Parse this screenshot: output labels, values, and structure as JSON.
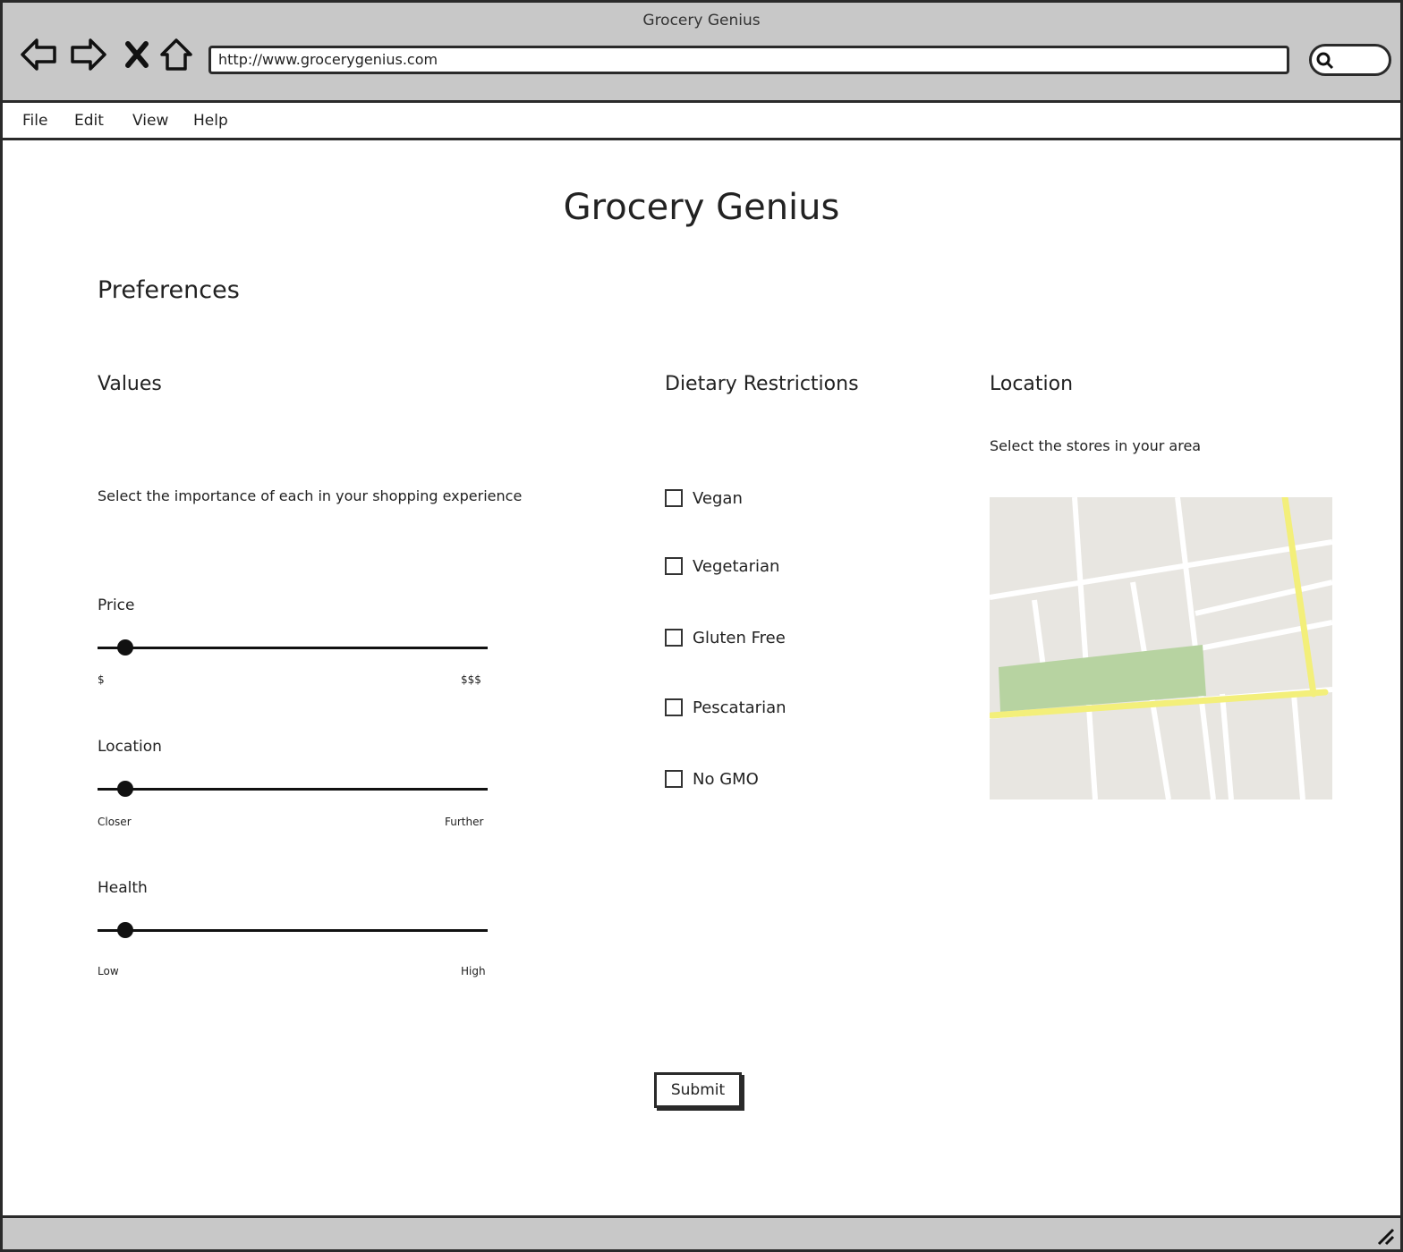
{
  "window": {
    "title": "Grocery Genius"
  },
  "toolbar": {
    "url": "http://www.grocerygenius.com",
    "icons": [
      "back-icon",
      "forward-icon",
      "close-icon",
      "home-icon",
      "search-icon"
    ]
  },
  "menu": {
    "items": [
      "File",
      "Edit",
      "View",
      "Help"
    ]
  },
  "page": {
    "title": "Grocery Genius",
    "section": "Preferences"
  },
  "values": {
    "heading": "Values",
    "description": "Select the importance of each in your shopping experience",
    "sliders": [
      {
        "label": "Price",
        "min_label": "$",
        "max_label": "$$$",
        "level": 0.07
      },
      {
        "label": "Location",
        "min_label": "Closer",
        "max_label": "Further",
        "level": 0.07
      },
      {
        "label": "Health",
        "min_label": "Low",
        "max_label": "High",
        "level": 0.07
      }
    ]
  },
  "dietary": {
    "heading": "Dietary Restrictions",
    "options": [
      {
        "label": "Vegan",
        "checked": false
      },
      {
        "label": "Vegetarian",
        "checked": false
      },
      {
        "label": "Gluten Free",
        "checked": false
      },
      {
        "label": "Pescatarian",
        "checked": false
      },
      {
        "label": "No GMO",
        "checked": false
      }
    ]
  },
  "location": {
    "heading": "Location",
    "description": "Select the stores in your area"
  },
  "submit": {
    "label": "Submit"
  },
  "colors": {
    "chrome": "#c8c8c8",
    "border": "#2a2a2a",
    "map_road": "#f3ef7a",
    "map_park": "#b7d3a1",
    "map_bg": "#e8e6e1"
  }
}
